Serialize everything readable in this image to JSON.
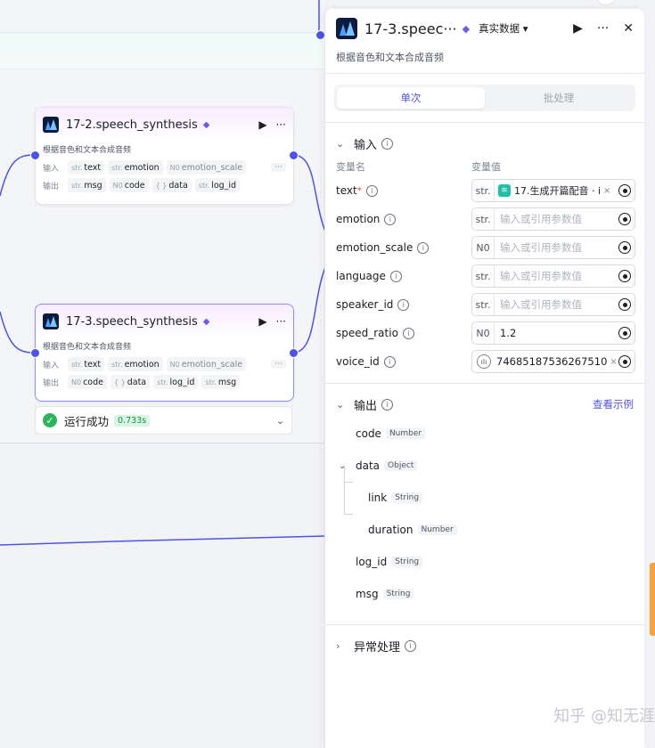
{
  "nodes": [
    {
      "title": "17-2.speech_synthesis",
      "desc": "根据音色和文本合成音频",
      "input_label": "输入",
      "output_label": "输出",
      "inputs": [
        {
          "type": "str.",
          "name": "text"
        },
        {
          "type": "str.",
          "name": "emotion"
        },
        {
          "type": "N0",
          "name": "emotion_scale"
        }
      ],
      "more": "···",
      "outputs": [
        {
          "type": "str.",
          "name": "msg"
        },
        {
          "type": "N0",
          "name": "code"
        },
        {
          "type": "{ }",
          "name": "data"
        },
        {
          "type": "str.",
          "name": "log_id"
        }
      ]
    },
    {
      "title": "17-3.speech_synthesis",
      "desc": "根据音色和文本合成音频",
      "input_label": "输入",
      "output_label": "输出",
      "inputs": [
        {
          "type": "str.",
          "name": "text"
        },
        {
          "type": "str.",
          "name": "emotion"
        },
        {
          "type": "N0",
          "name": "emotion_scale"
        }
      ],
      "more": "···",
      "outputs": [
        {
          "type": "N0",
          "name": "code"
        },
        {
          "type": "{ }",
          "name": "data"
        },
        {
          "type": "str.",
          "name": "log_id"
        },
        {
          "type": "str.",
          "name": "msg"
        }
      ]
    }
  ],
  "run_status": {
    "text": "运行成功",
    "time": "0.733s"
  },
  "panel": {
    "title": "17-3.speec···",
    "mode": "真实数据 ▾",
    "desc": "根据音色和文本合成音频",
    "tabs": [
      "单次",
      "批处理"
    ],
    "input_section": "输入",
    "col_name": "变量名",
    "col_value": "变量值",
    "inputs": [
      {
        "name": "text",
        "required": "*",
        "type": "str.",
        "ref": "17.生成开篇配音 · i",
        "placeholder": ""
      },
      {
        "name": "emotion",
        "required": "",
        "type": "str.",
        "placeholder": "输入或引用参数值"
      },
      {
        "name": "emotion_scale",
        "required": "",
        "type": "N0",
        "placeholder": "输入或引用参数值"
      },
      {
        "name": "language",
        "required": "",
        "type": "str.",
        "placeholder": "输入或引用参数值"
      },
      {
        "name": "speaker_id",
        "required": "",
        "type": "str.",
        "placeholder": "输入或引用参数值"
      },
      {
        "name": "speed_ratio",
        "required": "",
        "type": "N0",
        "value": "1.2"
      },
      {
        "name": "voice_id",
        "required": "",
        "type": "wave",
        "value": "74685187536267510"
      }
    ],
    "output_section": "输出",
    "view_example": "查看示例",
    "outputs": [
      {
        "name": "code",
        "type": "Number",
        "level": 0
      },
      {
        "name": "data",
        "type": "Object",
        "level": 0,
        "expanded": true
      },
      {
        "name": "link",
        "type": "String",
        "level": 1
      },
      {
        "name": "duration",
        "type": "Number",
        "level": 1
      },
      {
        "name": "log_id",
        "type": "String",
        "level": 0
      },
      {
        "name": "msg",
        "type": "String",
        "level": 0
      }
    ],
    "error_section": "异常处理"
  },
  "watermark": "知乎 @知无涯"
}
